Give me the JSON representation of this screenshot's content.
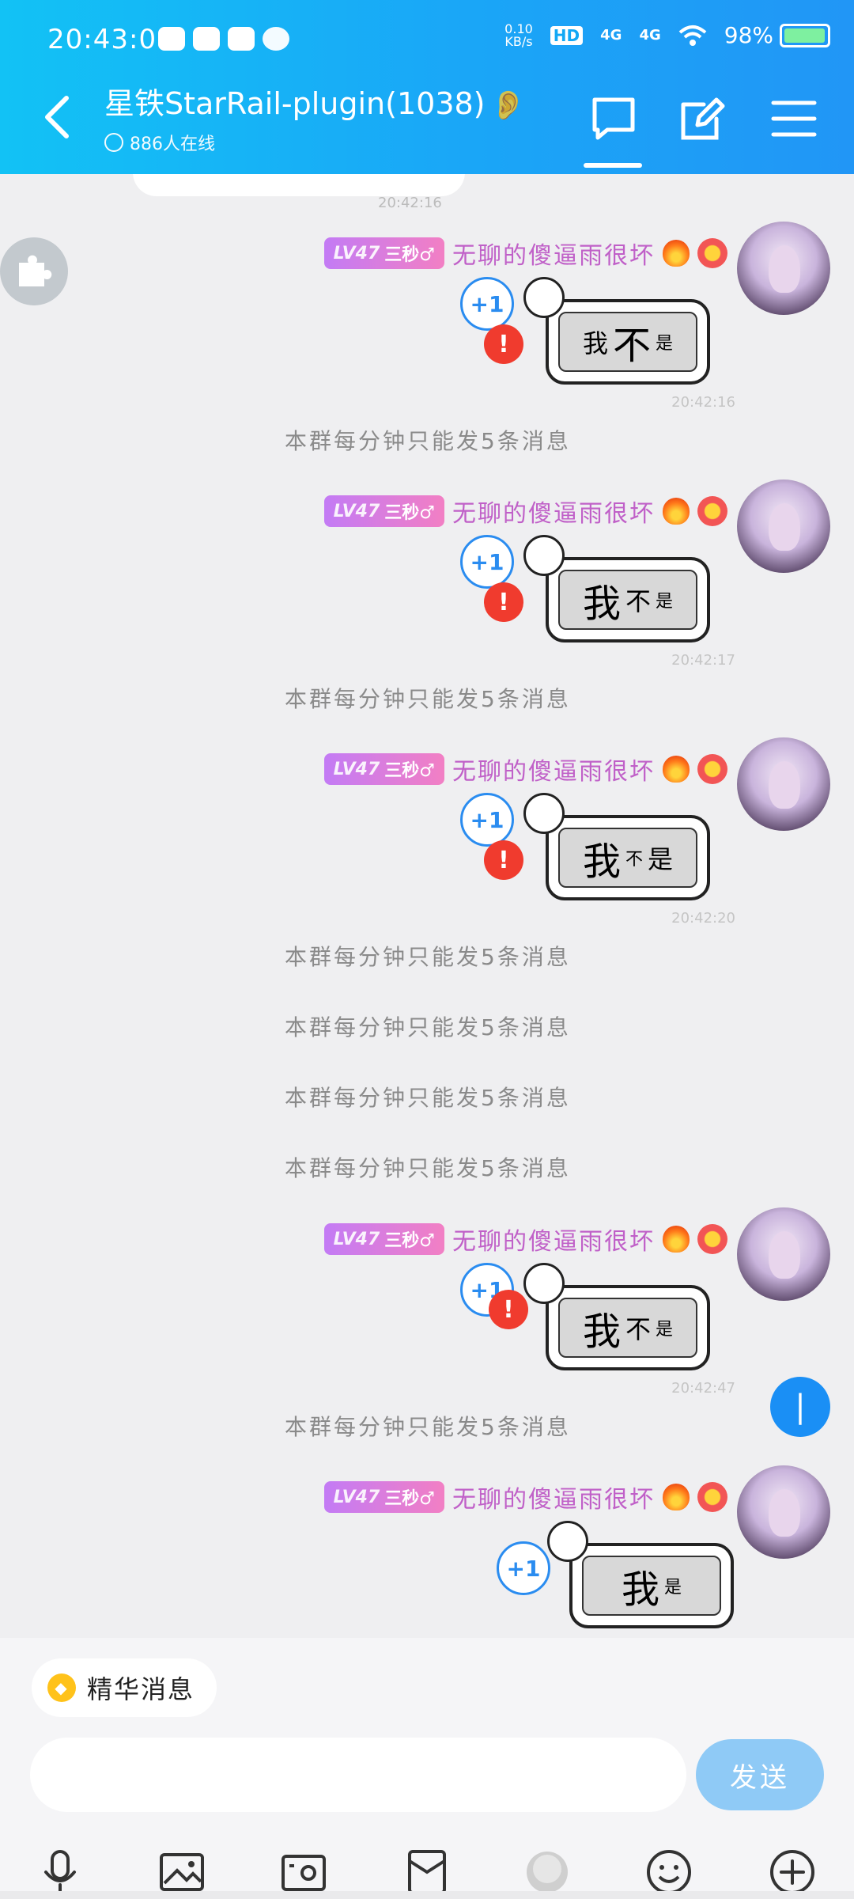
{
  "status_bar": {
    "time": "20:43:00",
    "net_speed_top": "0.10",
    "net_speed_bottom": "KB/s",
    "hd_label": "HD",
    "signal1": "4G",
    "signal2": "4G",
    "battery": "98%",
    "battery_level": 0.98
  },
  "header": {
    "title": "星铁StarRail-plugin(1038)",
    "online": "886人在线"
  },
  "top_timestamp": "20:42:16",
  "sender": {
    "level": "LV47",
    "title": "三秒♂",
    "nickname": "无聊的傻逼雨很坏"
  },
  "system_notice": "本群每分钟只能发5条消息",
  "messages": [
    {
      "time": "20:42:16",
      "sticker": [
        "我",
        "不",
        "是"
      ],
      "plus": "+1",
      "error": "!"
    },
    {
      "time": "20:42:17",
      "sticker": [
        "我",
        "不",
        "是"
      ],
      "plus": "+1",
      "error": "!"
    },
    {
      "time": "20:42:20",
      "sticker": [
        "我",
        "不",
        "是"
      ],
      "plus": "+1",
      "error": "!"
    },
    {
      "time": "20:42:47",
      "sticker": [
        "我",
        "不",
        "是"
      ],
      "plus": "+1",
      "error": "!"
    },
    {
      "time": "",
      "sticker": [
        "我",
        "",
        "是"
      ],
      "plus": "+1",
      "error": ""
    }
  ],
  "bottom": {
    "essence_label": "精华消息",
    "input_placeholder": "",
    "send_label": "发送"
  },
  "scroll_badge": "|",
  "icons": [
    "back-icon",
    "ear-icon",
    "chat-icon",
    "edit-icon",
    "menu-icon",
    "puzzle-icon",
    "mic-icon",
    "image-icon",
    "camera-icon",
    "redpacket-icon",
    "face-icon",
    "emoji-icon",
    "plus-icon"
  ],
  "colors": {
    "header_start": "#12c2f5",
    "header_end": "#2196f6",
    "nickname": "#c060c8",
    "badge_start": "#c37bf5",
    "badge_end": "#f27fc4",
    "error": "#f03b2e",
    "send": "#8fcaf6"
  }
}
